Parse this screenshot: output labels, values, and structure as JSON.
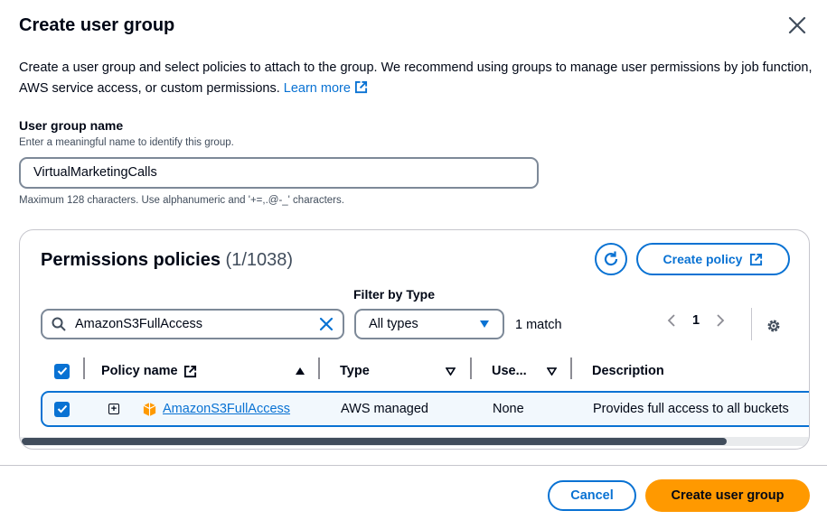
{
  "modal": {
    "title": "Create user group",
    "intro_text": "Create a user group and select policies to attach to the group. We recommend using groups to manage user permissions by job function, AWS service access, or custom permissions.",
    "learn_more": "Learn more"
  },
  "group_name": {
    "label": "User group name",
    "description": "Enter a meaningful name to identify this group.",
    "value": "VirtualMarketingCalls",
    "constraint": "Maximum 128 characters. Use alphanumeric and '+=,.@-_' characters."
  },
  "policies": {
    "title": "Permissions policies",
    "count": "(1/1038)",
    "create_policy_label": "Create policy",
    "filter_label": "Filter by Type",
    "search_value": "AmazonS3FullAccess",
    "type_select_value": "All types",
    "match_text": "1 match",
    "page_number": "1",
    "columns": {
      "policy_name": "Policy name",
      "type": "Type",
      "used_as": "Use...",
      "description": "Description"
    },
    "rows": [
      {
        "name": "AmazonS3FullAccess",
        "type": "AWS managed",
        "used_as": "None",
        "description": "Provides full access to all buckets"
      }
    ]
  },
  "footer": {
    "cancel_label": "Cancel",
    "create_label": "Create user group"
  },
  "colors": {
    "accent": "#0972d3",
    "primary_button": "#ff9900",
    "text": "#000716"
  },
  "icons": [
    "close-icon",
    "external-link-icon",
    "refresh-icon",
    "search-icon",
    "clear-icon",
    "caret-down-icon",
    "chevron-left-icon",
    "chevron-right-icon",
    "settings-icon",
    "checkbox-checked-icon",
    "expand-icon",
    "aws-policy-icon",
    "sort-ascending-icon",
    "sort-caret-icon"
  ]
}
